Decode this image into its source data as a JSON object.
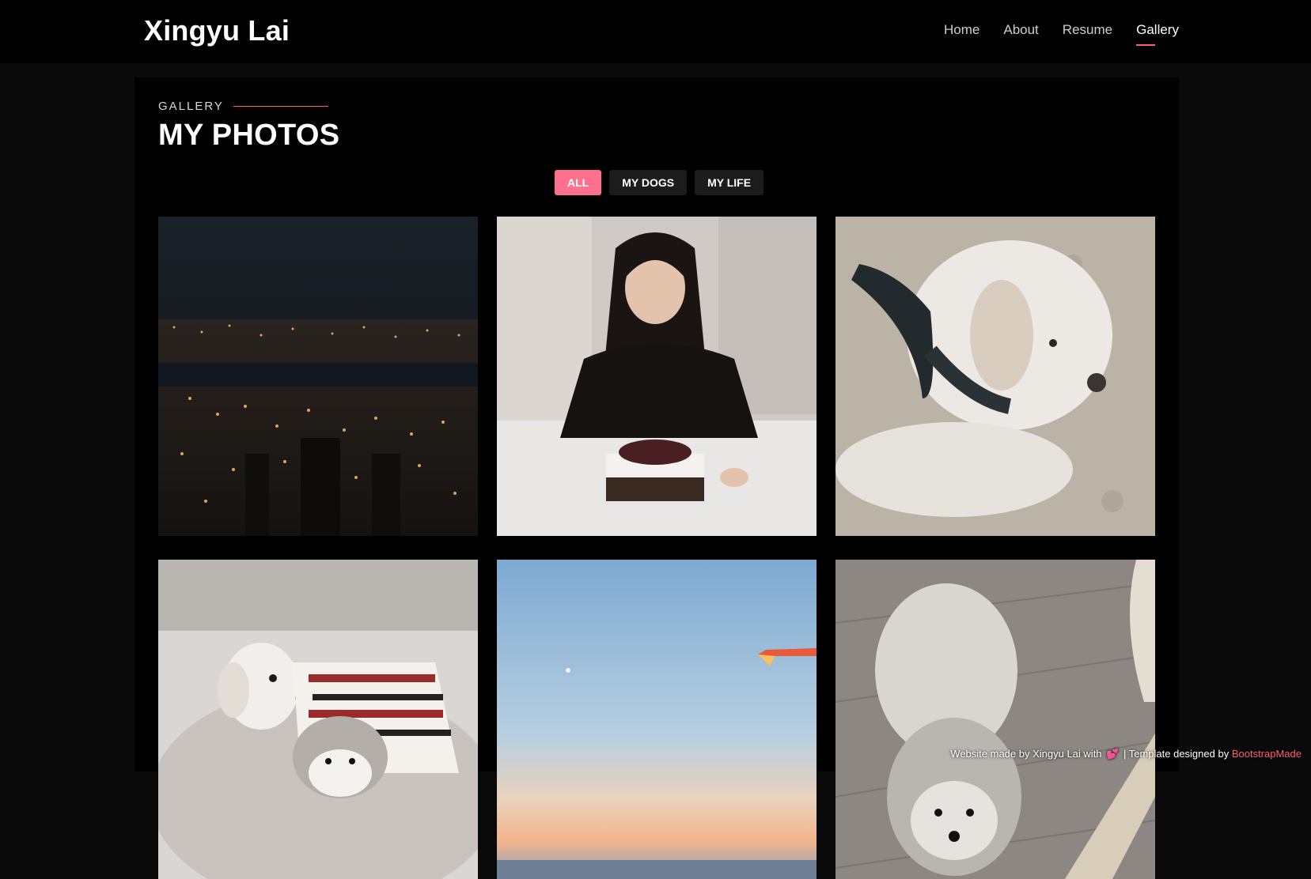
{
  "header": {
    "brand": "Xingyu Lai",
    "nav": [
      {
        "label": "Home",
        "active": false
      },
      {
        "label": "About",
        "active": false
      },
      {
        "label": "Resume",
        "active": false
      },
      {
        "label": "Gallery",
        "active": true
      }
    ]
  },
  "section": {
    "eyebrow": "GALLERY",
    "title": "MY PHOTOS"
  },
  "filters": [
    {
      "label": "ALL",
      "active": true
    },
    {
      "label": "MY DOGS",
      "active": false
    },
    {
      "label": "MY LIFE",
      "active": false
    }
  ],
  "photos": [
    {
      "subject": "city-night-skyline"
    },
    {
      "subject": "woman-cutting-cake"
    },
    {
      "subject": "white-dog-on-sand"
    },
    {
      "subject": "two-dogs-on-bed"
    },
    {
      "subject": "sky-airplane-wing"
    },
    {
      "subject": "grey-puppy-on-floor"
    }
  ],
  "footer": {
    "credit_prefix": "Website made by Xingyu Lai with",
    "heart_icon": "heart-icon",
    "credit_middle": "| Template designed by",
    "credit_link": "BootstrapMade"
  },
  "colors": {
    "accent": "#ff5d7a",
    "filter_active": "#ff6f8e",
    "page_bg": "#0a0a0a"
  }
}
